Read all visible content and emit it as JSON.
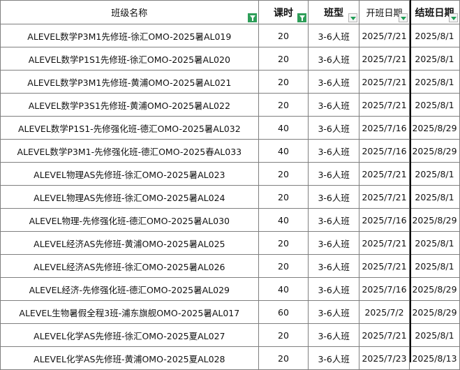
{
  "headers": [
    {
      "label": "班级名称",
      "filter": "active"
    },
    {
      "label": "课时",
      "filter": "active"
    },
    {
      "label": "班型",
      "filter": "dropdown"
    },
    {
      "label": "开班日期",
      "filter": "dropdown"
    },
    {
      "label": "结班日期",
      "filter": "dropdown"
    }
  ],
  "rows": [
    {
      "name": "ALEVEL数学P3M1先修班-徐汇OMO-2025暑AL019",
      "hours": "20",
      "type": "3-6人班",
      "start": "2025/7/21",
      "end": "2025/8/1"
    },
    {
      "name": "ALEVEL数学P1S1先修班-徐汇OMO-2025暑AL020",
      "hours": "20",
      "type": "3-6人班",
      "start": "2025/7/21",
      "end": "2025/8/1"
    },
    {
      "name": "ALEVEL数学P3M1先修班-黄浦OMO-2025暑AL021",
      "hours": "20",
      "type": "3-6人班",
      "start": "2025/7/21",
      "end": "2025/8/1"
    },
    {
      "name": "ALEVEL数学P3S1先修班-黄浦OMO-2025暑AL022",
      "hours": "20",
      "type": "3-6人班",
      "start": "2025/7/21",
      "end": "2025/8/1"
    },
    {
      "name": "ALEVEL数学P1S1-先修强化班-德汇OMO-2025暑AL032",
      "hours": "40",
      "type": "3-6人班",
      "start": "2025/7/16",
      "end": "2025/8/29"
    },
    {
      "name": "ALEVEL数学P3M1-先修强化班-德汇OMO-2025春AL033",
      "hours": "40",
      "type": "3-6人班",
      "start": "2025/7/16",
      "end": "2025/8/29"
    },
    {
      "name": "ALEVEL物理AS先修班-徐汇OMO-2025暑AL023",
      "hours": "20",
      "type": "3-6人班",
      "start": "2025/7/21",
      "end": "2025/8/1"
    },
    {
      "name": "ALEVEL物理AS先修班-徐汇OMO-2025暑AL024",
      "hours": "20",
      "type": "3-6人班",
      "start": "2025/7/21",
      "end": "2025/8/1"
    },
    {
      "name": "ALEVEL物理-先修强化班-德汇OMO-2025暑AL030",
      "hours": "40",
      "type": "3-6人班",
      "start": "2025/7/16",
      "end": "2025/8/29"
    },
    {
      "name": "ALEVEL经济AS先修班-黄浦OMO-2025暑AL025",
      "hours": "20",
      "type": "3-6人班",
      "start": "2025/7/21",
      "end": "2025/8/1"
    },
    {
      "name": "ALEVEL经济AS先修班-徐汇OMO-2025暑AL026",
      "hours": "20",
      "type": "3-6人班",
      "start": "2025/7/21",
      "end": "2025/8/1"
    },
    {
      "name": "ALEVEL经济-先修强化班-德汇OMO-2025暑AL029",
      "hours": "40",
      "type": "3-6人班",
      "start": "2025/7/16",
      "end": "2025/8/29"
    },
    {
      "name": "ALEVEL生物暑假全程3班-浦东旗舰OMO-2025暑AL017",
      "hours": "60",
      "type": "3-6人班",
      "start": "2025/7/2",
      "end": "2025/8/29"
    },
    {
      "name": "ALEVEL化学AS先修班-徐汇OMO-2025夏AL027",
      "hours": "20",
      "type": "3-6人班",
      "start": "2025/7/21",
      "end": "2025/8/1"
    },
    {
      "name": "ALEVEL化学AS先修班-黄浦OMO-2025夏AL028",
      "hours": "20",
      "type": "3-6人班",
      "start": "2025/7/23",
      "end": "2025/8/13"
    }
  ]
}
